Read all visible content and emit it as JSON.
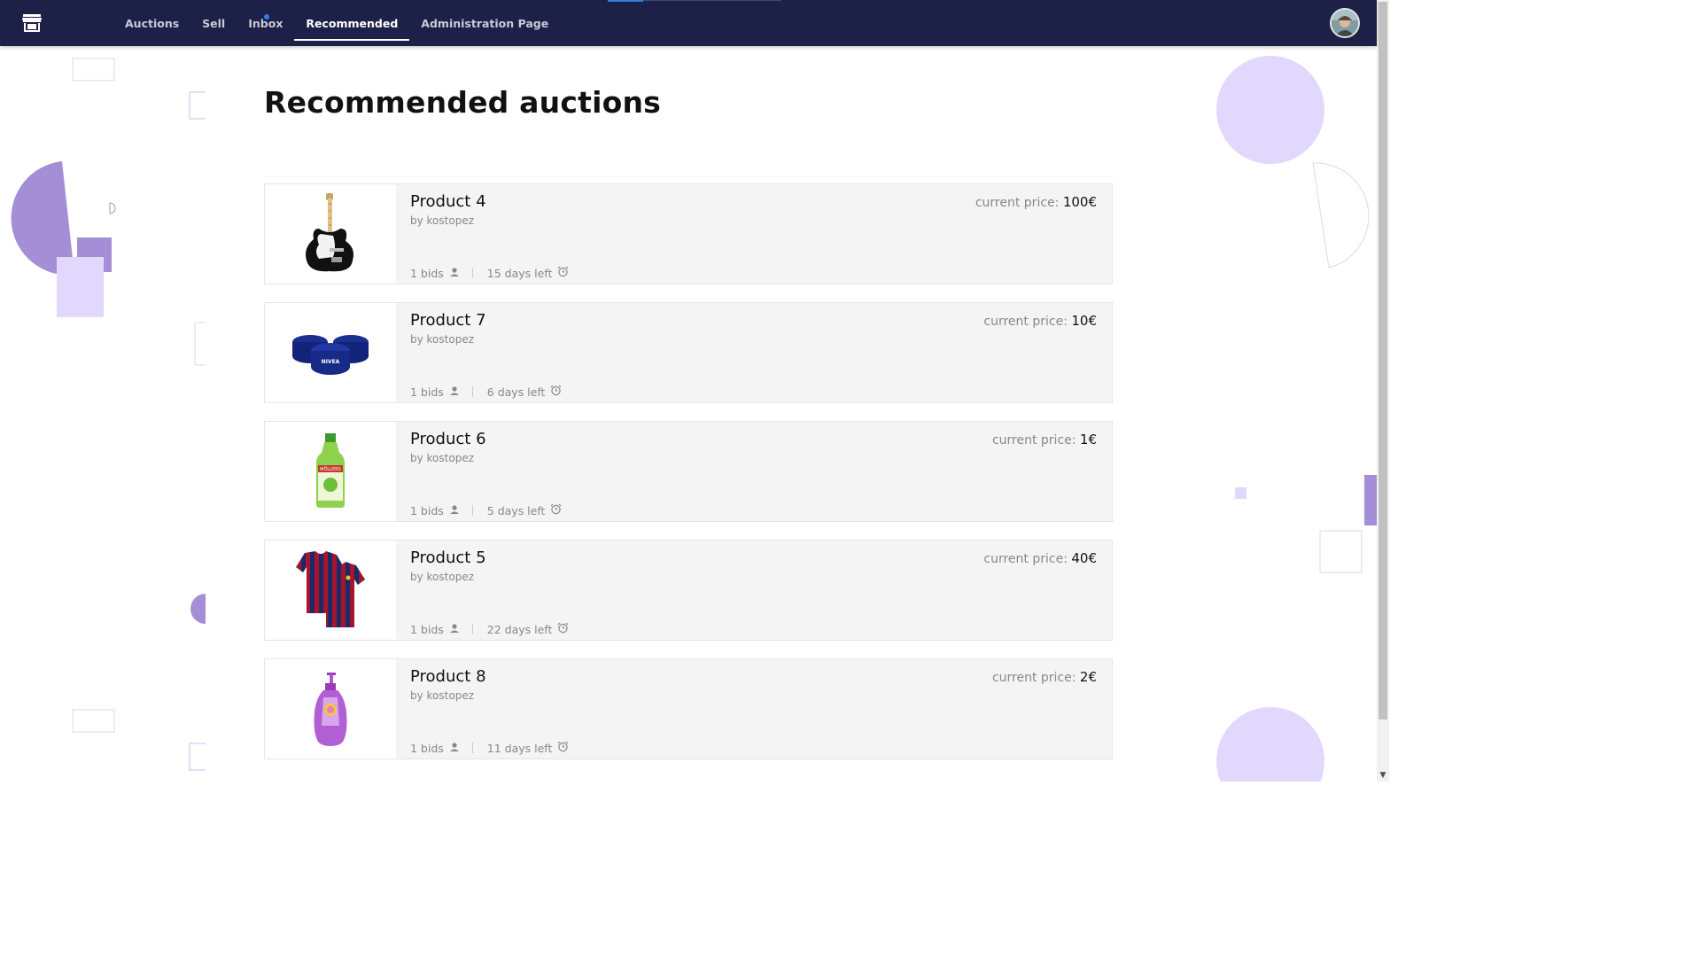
{
  "nav": {
    "logo_icon": "store-icon",
    "items": [
      {
        "label": "Auctions"
      },
      {
        "label": "Sell"
      },
      {
        "label": "Inbox"
      },
      {
        "label": "Recommended"
      },
      {
        "label": "Administration Page"
      }
    ],
    "active": "Recommended",
    "avatar_icon": "user-avatar"
  },
  "page": {
    "title": "Recommended auctions"
  },
  "price_label": "current price:",
  "auctions": [
    {
      "name": "Product 4",
      "seller": "by kostopez",
      "price": "100€",
      "bids": "1 bids",
      "time_left": "15 days left",
      "image_icon": "electric-guitar-image"
    },
    {
      "name": "Product 7",
      "seller": "by kostopez",
      "price": "10€",
      "bids": "1 bids",
      "time_left": "6 days left",
      "image_icon": "cream-tins-image"
    },
    {
      "name": "Product 6",
      "seller": "by kostopez",
      "price": "1€",
      "bids": "1 bids",
      "time_left": "5 days left",
      "image_icon": "green-bottle-image"
    },
    {
      "name": "Product 5",
      "seller": "by kostopez",
      "price": "40€",
      "bids": "1 bids",
      "time_left": "22 days left",
      "image_icon": "football-jersey-image"
    },
    {
      "name": "Product 8",
      "seller": "by kostopez",
      "price": "2€",
      "bids": "1 bids",
      "time_left": "11 days left",
      "image_icon": "shampoo-bottle-image"
    }
  ],
  "colors": {
    "navbar": "#1e2147",
    "card_bg": "#f4f4f4",
    "deco_purple": "#a48fd6",
    "deco_light": "#e2d7fd"
  }
}
